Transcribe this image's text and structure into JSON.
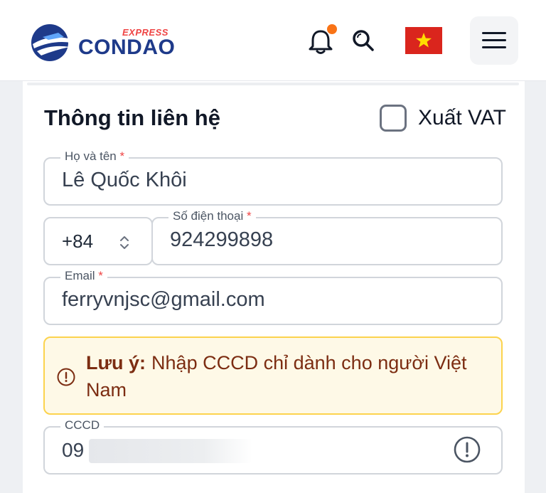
{
  "header": {
    "brand_name": "CONDAO",
    "brand_tag": "EXPRESS",
    "language_flag": "vietnam-flag",
    "has_notification": true
  },
  "contact": {
    "title": "Thông tin liên hệ",
    "vat_label": "Xuất VAT",
    "vat_checked": false,
    "name_label": "Họ và tên",
    "name_value": "Lê Quốc Khôi",
    "country_code": "+84",
    "phone_label": "Số điện thoại",
    "phone_value": "924299898",
    "email_label": "Email",
    "email_value": "ferryvnjsc@gmail.com",
    "required_mark": "*"
  },
  "notice": {
    "label": "Lưu ý:",
    "text": "Nhập CCCD chỉ dành cho người Việt Nam"
  },
  "cccd": {
    "label": "CCCD",
    "value_visible": "09"
  },
  "colors": {
    "brand_blue": "#1e3a8a",
    "accent_red": "#ef4444",
    "notification_dot": "#f97316",
    "notice_bg": "#fef9e7",
    "notice_border": "#fcd34d",
    "notice_text": "#7c2d12"
  }
}
